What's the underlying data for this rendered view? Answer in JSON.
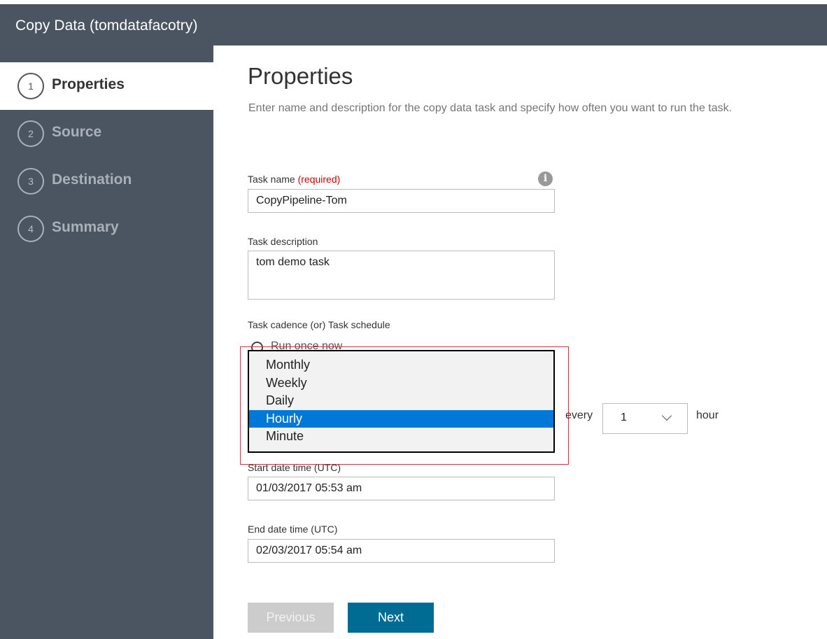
{
  "header": {
    "title": "Copy Data (tomdatafacotry)"
  },
  "steps": [
    {
      "number": "1",
      "label": "Properties",
      "active": true
    },
    {
      "number": "2",
      "label": "Source",
      "active": false
    },
    {
      "number": "3",
      "label": "Destination",
      "active": false
    },
    {
      "number": "4",
      "label": "Summary",
      "active": false
    }
  ],
  "main": {
    "title": "Properties",
    "description": "Enter name and description for the copy data task and specify how often you want to run the task.",
    "task_name": {
      "label": "Task name",
      "required_text": "(required)",
      "value": "CopyPipeline-Tom"
    },
    "task_description": {
      "label": "Task description",
      "value": "tom demo task"
    },
    "cadence": {
      "label": "Task cadence (or) Task schedule",
      "run_once_label": "Run once now",
      "frequency_options": [
        "Monthly",
        "Weekly",
        "Daily",
        "Hourly",
        "Minute"
      ],
      "selected_frequency": "Hourly",
      "every_label": "every",
      "interval_value": "1",
      "unit_label": "hour"
    },
    "start_date": {
      "label": "Start date time (UTC)",
      "value": "01/03/2017 05:53 am"
    },
    "end_date": {
      "label": "End date time (UTC)",
      "value": "02/03/2017 05:54 am"
    }
  },
  "buttons": {
    "previous": "Previous",
    "next": "Next"
  },
  "icons": {
    "info": "info-icon",
    "dropdown": "chevron-down-icon"
  },
  "colors": {
    "header_bg": "#4b5562",
    "accent": "#0078d7",
    "next_button": "#006c93",
    "required": "#d00000"
  }
}
